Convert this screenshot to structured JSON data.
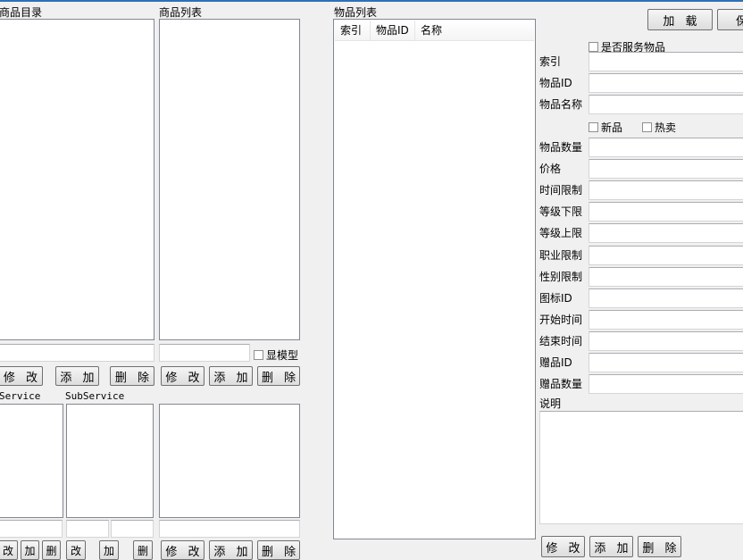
{
  "left": {
    "catalog_label": "商品目录",
    "list_label": "商品列表",
    "show_model_label": "显模型",
    "service_label": "Service",
    "subservice_label": "SubService",
    "edit_label": "修 改",
    "add_label": "添 加",
    "delete_label": "删 除",
    "small_edit": "改",
    "small_add": "加",
    "small_delete": "删"
  },
  "items": {
    "label": "物品列表",
    "columns": [
      "索引",
      "物品ID",
      "名称"
    ]
  },
  "form": {
    "load_label": "加 载",
    "save_label": "保",
    "is_service_label": "是否服务物品",
    "new_label": "新品",
    "hot_label": "热卖",
    "fields": [
      "索引",
      "物品ID",
      "物品名称",
      "物品数量",
      "价格",
      "时间限制",
      "等级下限",
      "等级上限",
      "职业限制",
      "性别限制",
      "图标ID",
      "开始时间",
      "结束时间",
      "赠品ID",
      "赠品数量"
    ],
    "desc_label": "说明",
    "edit_label": "修 改",
    "add_label": "添 加",
    "delete_label": "删 除"
  }
}
